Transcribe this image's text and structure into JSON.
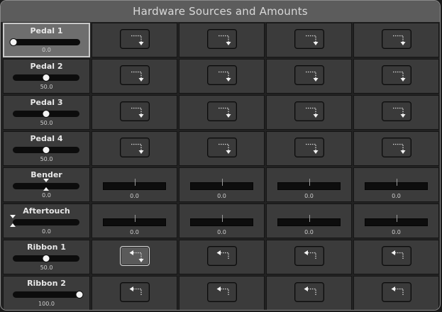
{
  "title": "Hardware Sources and Amounts",
  "sources": [
    {
      "label": "Pedal 1",
      "value": "0.0",
      "position": 0.0,
      "kind": "unipolar",
      "selected": true
    },
    {
      "label": "Pedal 2",
      "value": "50.0",
      "position": 0.5,
      "kind": "unipolar",
      "selected": false
    },
    {
      "label": "Pedal 3",
      "value": "50.0",
      "position": 0.5,
      "kind": "unipolar",
      "selected": false
    },
    {
      "label": "Pedal 4",
      "value": "50.0",
      "position": 0.5,
      "kind": "unipolar",
      "selected": false
    },
    {
      "label": "Bender",
      "value": "0.0",
      "position": 0.5,
      "kind": "bipolar",
      "selected": false
    },
    {
      "label": "Aftertouch",
      "value": "0.0",
      "position": 0.0,
      "kind": "bipolar",
      "selected": false
    },
    {
      "label": "Ribbon 1",
      "value": "50.0",
      "position": 0.5,
      "kind": "unipolar",
      "selected": false
    },
    {
      "label": "Ribbon 2",
      "value": "100.0",
      "position": 1.0,
      "kind": "unipolar",
      "selected": false
    }
  ],
  "rows": [
    {
      "cells": [
        {
          "type": "route",
          "icon": "return-down-icon"
        },
        {
          "type": "route",
          "icon": "return-down-icon"
        },
        {
          "type": "route",
          "icon": "return-down-icon"
        },
        {
          "type": "route",
          "icon": "return-down-icon"
        }
      ]
    },
    {
      "cells": [
        {
          "type": "route",
          "icon": "return-down-icon"
        },
        {
          "type": "route",
          "icon": "return-down-icon"
        },
        {
          "type": "route",
          "icon": "return-down-icon"
        },
        {
          "type": "route",
          "icon": "return-down-icon"
        }
      ]
    },
    {
      "cells": [
        {
          "type": "route",
          "icon": "return-down-icon"
        },
        {
          "type": "route",
          "icon": "return-down-icon"
        },
        {
          "type": "route",
          "icon": "return-down-icon"
        },
        {
          "type": "route",
          "icon": "return-down-icon"
        }
      ]
    },
    {
      "cells": [
        {
          "type": "route",
          "icon": "return-down-icon"
        },
        {
          "type": "route",
          "icon": "return-down-icon"
        },
        {
          "type": "route",
          "icon": "return-down-icon"
        },
        {
          "type": "route",
          "icon": "return-down-icon"
        }
      ]
    },
    {
      "cells": [
        {
          "type": "amount",
          "value": "0.0"
        },
        {
          "type": "amount",
          "value": "0.0"
        },
        {
          "type": "amount",
          "value": "0.0"
        },
        {
          "type": "amount",
          "value": "0.0"
        }
      ]
    },
    {
      "cells": [
        {
          "type": "amount",
          "value": "0.0"
        },
        {
          "type": "amount",
          "value": "0.0"
        },
        {
          "type": "amount",
          "value": "0.0"
        },
        {
          "type": "amount",
          "value": "0.0"
        }
      ]
    },
    {
      "cells": [
        {
          "type": "route",
          "icon": "return-both-icon",
          "active": true
        },
        {
          "type": "route",
          "icon": "return-left-icon"
        },
        {
          "type": "route",
          "icon": "return-left-icon"
        },
        {
          "type": "route",
          "icon": "return-left-icon"
        }
      ]
    },
    {
      "cells": [
        {
          "type": "route",
          "icon": "return-left-icon"
        },
        {
          "type": "route",
          "icon": "return-left-icon"
        },
        {
          "type": "route",
          "icon": "return-left-icon"
        },
        {
          "type": "route",
          "icon": "return-left-icon"
        }
      ]
    }
  ],
  "colors": {
    "panel": "#3b3b3b",
    "titlebar": "#5c5c5c",
    "selected": "#6e6e6e",
    "accent": "#f4f4f4"
  }
}
